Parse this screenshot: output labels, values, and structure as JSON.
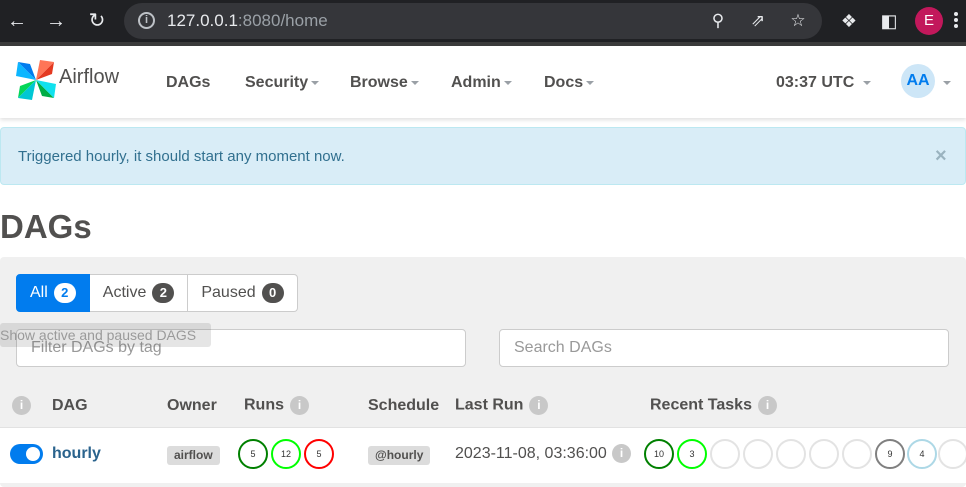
{
  "browser": {
    "url_host": "127.0.0.1",
    "url_rest": ":8080/home",
    "profile_initial": "E"
  },
  "navbar": {
    "brand": "Airflow",
    "items": [
      "DAGs",
      "Security",
      "Browse",
      "Admin",
      "Docs"
    ],
    "clock": "03:37 UTC",
    "user_initials": "AA"
  },
  "alert": {
    "message": "Triggered hourly, it should start any moment now.",
    "close": "×"
  },
  "page": {
    "title": "DAGs"
  },
  "filters": {
    "all_label": "All",
    "all_count": "2",
    "active_label": "Active",
    "active_count": "2",
    "paused_label": "Paused",
    "paused_count": "0",
    "tooltip": "Show active and paused DAGS",
    "tag_placeholder": "Filter DAGs by tag",
    "search_placeholder": "Search DAGs"
  },
  "table": {
    "headers": {
      "dag": "DAG",
      "owner": "Owner",
      "runs": "Runs",
      "schedule": "Schedule",
      "last_run": "Last Run",
      "recent_tasks": "Recent Tasks"
    },
    "info_glyph": "i",
    "row": {
      "dag_id": "hourly",
      "owner": "airflow",
      "runs": [
        {
          "count": "5",
          "color": "#008000"
        },
        {
          "count": "12",
          "color": "#00ff00"
        },
        {
          "count": "5",
          "color": "#ff0000"
        }
      ],
      "schedule": "@hourly",
      "last_run": "2023-11-08, 03:36:00",
      "recent_tasks": [
        {
          "count": "10",
          "color": "#008000"
        },
        {
          "count": "3",
          "color": "#00ff00"
        },
        {
          "count": "",
          "color": "#e3e3e3"
        },
        {
          "count": "",
          "color": "#e3e3e3"
        },
        {
          "count": "",
          "color": "#e3e3e3"
        },
        {
          "count": "",
          "color": "#e3e3e3"
        },
        {
          "count": "",
          "color": "#e3e3e3"
        },
        {
          "count": "9",
          "color": "#808080"
        },
        {
          "count": "4",
          "color": "#add8e6"
        },
        {
          "count": "",
          "color": "#e3e3e3"
        }
      ]
    }
  }
}
